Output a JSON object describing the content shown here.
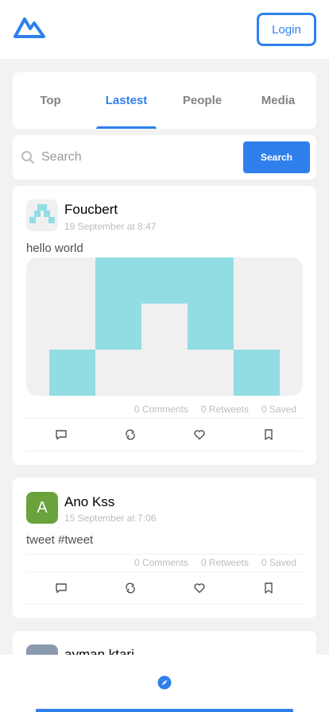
{
  "header": {
    "logo_icon": "mountain-logo-icon",
    "login_label": "Login"
  },
  "tabs": [
    {
      "label": "Top",
      "active": false
    },
    {
      "label": "Lastest",
      "active": true
    },
    {
      "label": "People",
      "active": false
    },
    {
      "label": "Media",
      "active": false
    }
  ],
  "search": {
    "placeholder": "Search",
    "value": "",
    "button_label": "Search",
    "icon": "search-icon"
  },
  "posts": [
    {
      "author": "Foucbert",
      "date": "19 September at 8:47",
      "text": "hello world",
      "has_image": true,
      "comments": "0 Comments",
      "retweets": "0 Retweets",
      "saved": "0 Saved"
    },
    {
      "author": "Ano Kss",
      "avatar_letter": "A",
      "date": "15 September at 7:06",
      "text": "tweet #tweet",
      "has_image": false,
      "comments": "0 Comments",
      "retweets": "0 Retweets",
      "saved": "0 Saved"
    },
    {
      "author": "ayman ktari"
    }
  ],
  "actions": {
    "comment_icon": "comment-icon",
    "retweet_icon": "retweet-icon",
    "like_icon": "heart-icon",
    "save_icon": "bookmark-icon"
  },
  "bottom_nav": {
    "explore_icon": "compass-icon"
  },
  "colors": {
    "accent": "#2f80ed",
    "identicon": "#92dde4",
    "avatar_green": "#6aa23c"
  }
}
